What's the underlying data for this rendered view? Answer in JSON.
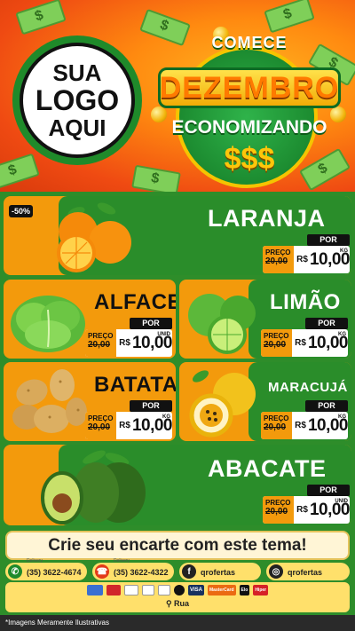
{
  "header": {
    "logo_lines": [
      "SUA",
      "LOGO",
      "AQUI"
    ],
    "promo_top": "COMECE",
    "promo_main": "DEZEMBRO",
    "promo_sub": "ECONOMIZANDO",
    "promo_money": "$$$"
  },
  "products": {
    "laranja": {
      "name": "LARANJA",
      "badge": "-50%",
      "preco_label": "PREÇO",
      "por_label": "POR",
      "old_price": "20,00",
      "currency": "R$",
      "price": "10,00",
      "unit": "KG"
    },
    "alface": {
      "name": "ALFACE",
      "preco_label": "PREÇO",
      "por_label": "POR",
      "old_price": "20,00",
      "currency": "R$",
      "price": "10,00",
      "unit": "UNID"
    },
    "limao": {
      "name": "LIMÃO",
      "preco_label": "PREÇO",
      "por_label": "POR",
      "old_price": "20,00",
      "currency": "R$",
      "price": "10,00",
      "unit": "KG"
    },
    "batata": {
      "name": "BATATA",
      "preco_label": "PREÇO",
      "por_label": "POR",
      "old_price": "20,00",
      "currency": "R$",
      "price": "10,00",
      "unit": "KG"
    },
    "maracuja": {
      "name": "MARACUJÁ",
      "preco_label": "PREÇO",
      "por_label": "POR",
      "old_price": "20,00",
      "currency": "R$",
      "price": "10,00",
      "unit": "KG"
    },
    "abacate": {
      "name": "ABACATE",
      "preco_label": "PREÇO",
      "por_label": "POR",
      "old_price": "20,00",
      "currency": "R$",
      "price": "10,00",
      "unit": "UNID"
    }
  },
  "cta": "Crie seu encarte com este tema!",
  "contacts": {
    "whatsapp": {
      "label": "Delivery",
      "value": "(35) 3622-4674"
    },
    "phone": {
      "label": "Delivery",
      "value": "(35) 3622-4322"
    },
    "facebook": {
      "value": "qrofertas"
    },
    "instagram": {
      "value": "qrofertas"
    }
  },
  "payments": {
    "cards": [
      "VISA",
      "MasterCard",
      "Elo",
      "Hiper"
    ],
    "address": "Rua"
  },
  "footer": "*Imagens Meramente Ilustrativas",
  "colors": {
    "green": "#2a8d2a",
    "orange": "#f39a0c",
    "header_red": "#ef4a12",
    "yellow": "#ffe06b"
  }
}
